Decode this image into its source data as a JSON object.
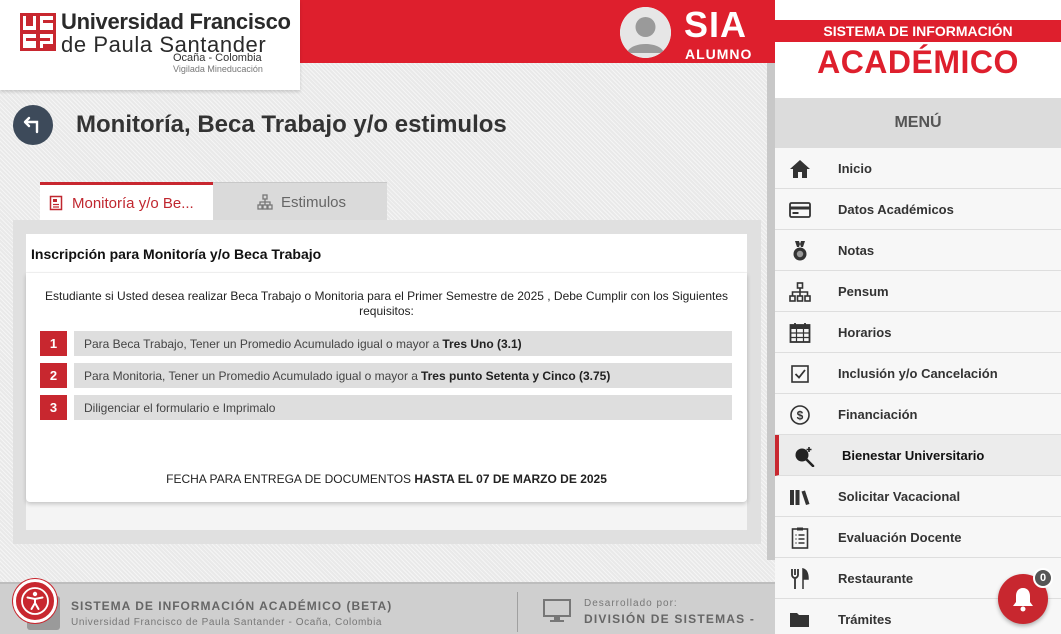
{
  "header": {
    "logo_line1": "Universidad Francisco",
    "logo_line2": "de Paula Santander",
    "logo_line3": "Ocaña - Colombia",
    "logo_line4": "Vigilada Mineducación",
    "brand_title": "SIA",
    "brand_subtitle": "ALUMNO",
    "accent_color": "#de1f2d"
  },
  "page": {
    "title": "Monitoría, Beca Trabajo y/o estimulos",
    "back_icon": "arrow-left-icon"
  },
  "tabs": [
    {
      "label": "Monitoría y/o Be...",
      "icon": "id-card-icon",
      "active": true
    },
    {
      "label": "Estimulos",
      "icon": "sitemap-icon",
      "active": false
    }
  ],
  "card": {
    "title": "Inscripción para Monitoría y/o Beca Trabajo",
    "intro": "Estudiante si Usted desea realizar Beca Trabajo o Monitoria para el Primer Semestre de 2025 , Debe Cumplir con los Siguientes requisitos:",
    "requirements": [
      {
        "num": "1",
        "text": "Para Beca Trabajo, Tener un Promedio Acumulado igual o mayor a",
        "bold": "Tres Uno (3.1)"
      },
      {
        "num": "2",
        "text": "Para Monitoria, Tener un Promedio Acumulado igual o mayor a",
        "bold": "Tres punto Setenta y Cinco (3.75)"
      },
      {
        "num": "3",
        "text": "Diligenciar el formulario e Imprimalo",
        "bold": ""
      }
    ],
    "fecha_text": "FECHA PARA ENTREGA DE DOCUMENTOS",
    "fecha_bold": "HASTA EL 07 DE MARZO DE 2025"
  },
  "footer": {
    "line1": "SISTEMA DE INFORMACIÓN ACADÉMICO (BETA)",
    "line2": "Universidad Francisco de Paula Santander - Ocaña, Colombia",
    "dev_label": "Desarrollado por:",
    "dev_name": "DIVISIÓN DE SISTEMAS -"
  },
  "sidebar": {
    "title1": "SISTEMA DE INFORMACIÓN",
    "title2": "ACADÉMICO",
    "menu_label": "MENÚ",
    "items": [
      {
        "label": "Inicio",
        "icon": "home-icon"
      },
      {
        "label": "Datos Académicos",
        "icon": "credit-card-icon"
      },
      {
        "label": "Notas",
        "icon": "medal-icon"
      },
      {
        "label": "Pensum",
        "icon": "sitemap-icon"
      },
      {
        "label": "Horarios",
        "icon": "calendar-icon"
      },
      {
        "label": "Inclusión y/o Cancelación",
        "icon": "checkbox-icon"
      },
      {
        "label": "Financiación",
        "icon": "dollar-icon"
      },
      {
        "label": "Bienestar Universitario",
        "icon": "search-plus-icon",
        "active": true
      },
      {
        "label": "Solicitar Vacacional",
        "icon": "books-icon"
      },
      {
        "label": "Evaluación Docente",
        "icon": "clipboard-icon"
      },
      {
        "label": "Restaurante",
        "icon": "utensils-icon"
      },
      {
        "label": "Trámites",
        "icon": "folder-icon"
      }
    ]
  },
  "notifications": {
    "count": "0"
  }
}
